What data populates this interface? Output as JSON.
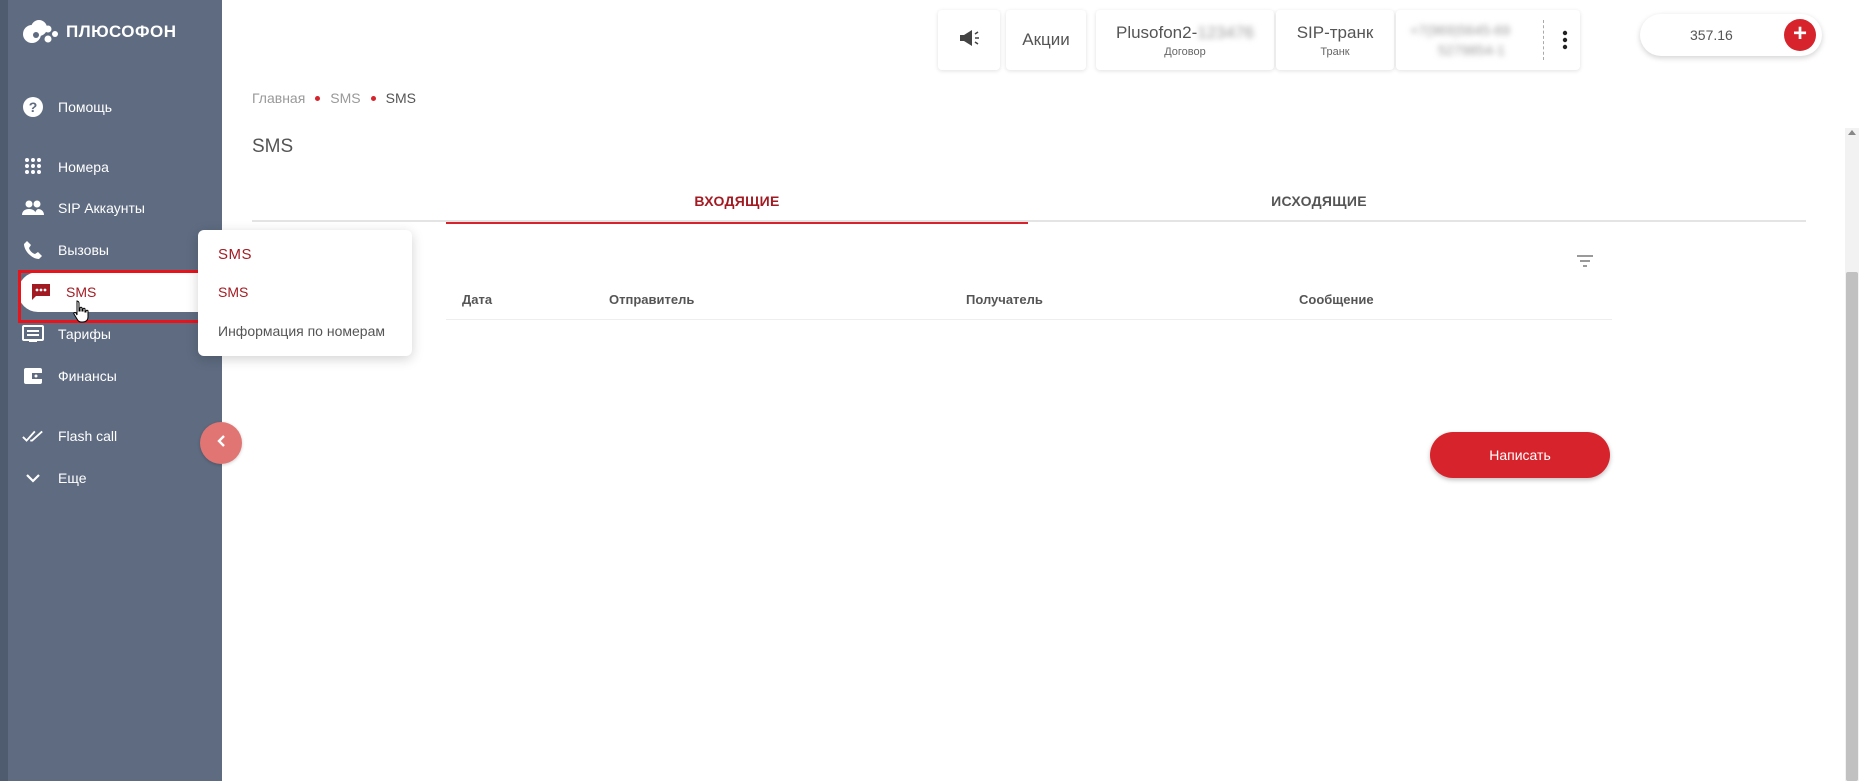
{
  "app": {
    "logo_text": "ПЛЮСОФОН"
  },
  "sidebar": {
    "items": [
      {
        "label": "Помощь",
        "icon": "help-icon"
      },
      {
        "label": "Номера",
        "icon": "dialpad-icon"
      },
      {
        "label": "SIP Аккаунты",
        "icon": "people-icon"
      },
      {
        "label": "Вызовы",
        "icon": "phone-icon"
      },
      {
        "label": "SMS",
        "icon": "sms-icon"
      },
      {
        "label": "Тарифы",
        "icon": "tariff-icon"
      },
      {
        "label": "Финансы",
        "icon": "wallet-icon"
      },
      {
        "label": "Flash call",
        "icon": "double-check-icon"
      },
      {
        "label": "Еще",
        "icon": "chevron-down-icon"
      }
    ]
  },
  "topbar": {
    "promo": "Акции",
    "contract": {
      "name": "Plusofon2-",
      "name_blurred": "123476",
      "caption": "Договор"
    },
    "trunk": {
      "name": "SIP-транк",
      "caption": "Транк"
    },
    "phone_blurred": {
      "line1": "+7(969)5645-69",
      "line2": "5279854-1"
    },
    "balance": "357.16",
    "add_label": "+"
  },
  "breadcrumb": [
    "Главная",
    "SMS",
    "SMS"
  ],
  "page": {
    "title": "SMS",
    "tabs": [
      {
        "label": "ВХОДЯЩИЕ"
      },
      {
        "label": "ИСХОДЯЩИЕ"
      }
    ],
    "table": {
      "columns": [
        "Дата",
        "Отправитель",
        "Получатель",
        "Сообщение"
      ]
    },
    "write_button": "Написать"
  },
  "flyout": {
    "title": "SMS",
    "items": [
      "SMS",
      "Информация по номерам"
    ]
  },
  "colors": {
    "sidebar": "#5e6b80",
    "accent": "#d7232b",
    "accent_dark": "#a31b22"
  }
}
